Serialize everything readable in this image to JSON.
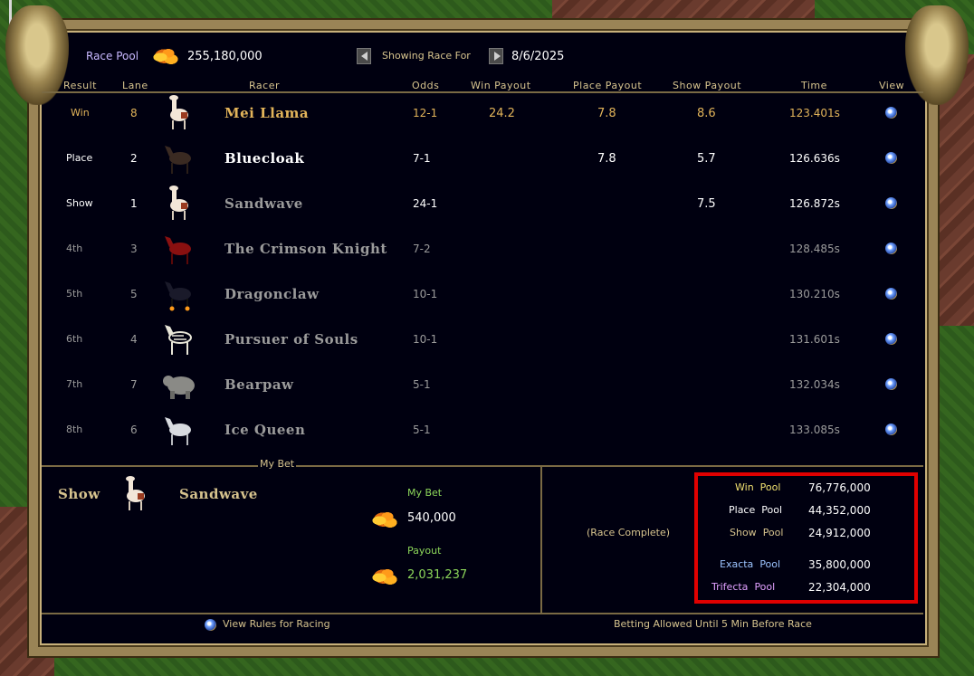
{
  "header": {
    "race_pool_label": "Race Pool",
    "race_pool_value": "255,180,000",
    "showing_label": "Showing Race For",
    "date": "8/6/2025"
  },
  "columns": [
    "Result",
    "Lane",
    "Racer",
    "Odds",
    "Win Payout",
    "Place Payout",
    "Show Payout",
    "Time",
    "View"
  ],
  "rows": [
    {
      "result": "Win",
      "lane": "8",
      "racer": "Mei Llama",
      "odds": "12-1",
      "win": "24.2",
      "place": "7.8",
      "show": "8.6",
      "time": "123.401s",
      "mount": "llama"
    },
    {
      "result": "Place",
      "lane": "2",
      "racer": "Bluecloak",
      "odds": "7-1",
      "win": "",
      "place": "7.8",
      "show": "5.7",
      "time": "126.636s",
      "mount": "horse-dark"
    },
    {
      "result": "Show",
      "lane": "1",
      "racer": "Sandwave",
      "odds": "24-1",
      "win": "",
      "place": "",
      "show": "7.5",
      "time": "126.872s",
      "mount": "llama"
    },
    {
      "result": "4th",
      "lane": "3",
      "racer": "The Crimson Knight",
      "odds": "7-2",
      "win": "",
      "place": "",
      "show": "",
      "time": "128.485s",
      "mount": "horse-red"
    },
    {
      "result": "5th",
      "lane": "5",
      "racer": "Dragonclaw",
      "odds": "10-1",
      "win": "",
      "place": "",
      "show": "",
      "time": "130.210s",
      "mount": "nightmare"
    },
    {
      "result": "6th",
      "lane": "4",
      "racer": "Pursuer of Souls",
      "odds": "10-1",
      "win": "",
      "place": "",
      "show": "",
      "time": "131.601s",
      "mount": "skeletal"
    },
    {
      "result": "7th",
      "lane": "7",
      "racer": "Bearpaw",
      "odds": "5-1",
      "win": "",
      "place": "",
      "show": "",
      "time": "132.034s",
      "mount": "bear"
    },
    {
      "result": "8th",
      "lane": "6",
      "racer": "Ice Queen",
      "odds": "5-1",
      "win": "",
      "place": "",
      "show": "",
      "time": "133.085s",
      "mount": "horse-white"
    }
  ],
  "my_bet": {
    "section_label": "My Bet",
    "type": "Show",
    "racer": "Sandwave",
    "bet_label": "My Bet",
    "bet_amount": "540,000",
    "payout_label": "Payout",
    "payout_amount": "2,031,237"
  },
  "status": "(Race Complete)",
  "pools": {
    "win_label": "Win",
    "win_value": "76,776,000",
    "place_label": "Place",
    "place_value": "44,352,000",
    "show_label": "Show",
    "show_value": "24,912,000",
    "exacta_label": "Exacta",
    "exacta_value": "35,800,000",
    "trifecta_label": "Trifecta",
    "trifecta_value": "22,304,000",
    "pool_word": "Pool"
  },
  "footer": {
    "rules_link": "View Rules for Racing",
    "betting_note": "Betting Allowed Until 5 Min Before Race"
  },
  "colors": {
    "frame": "#9a8456",
    "panel": "#000010",
    "highlight": "#e00000",
    "gold_text": "#e2b45a"
  }
}
